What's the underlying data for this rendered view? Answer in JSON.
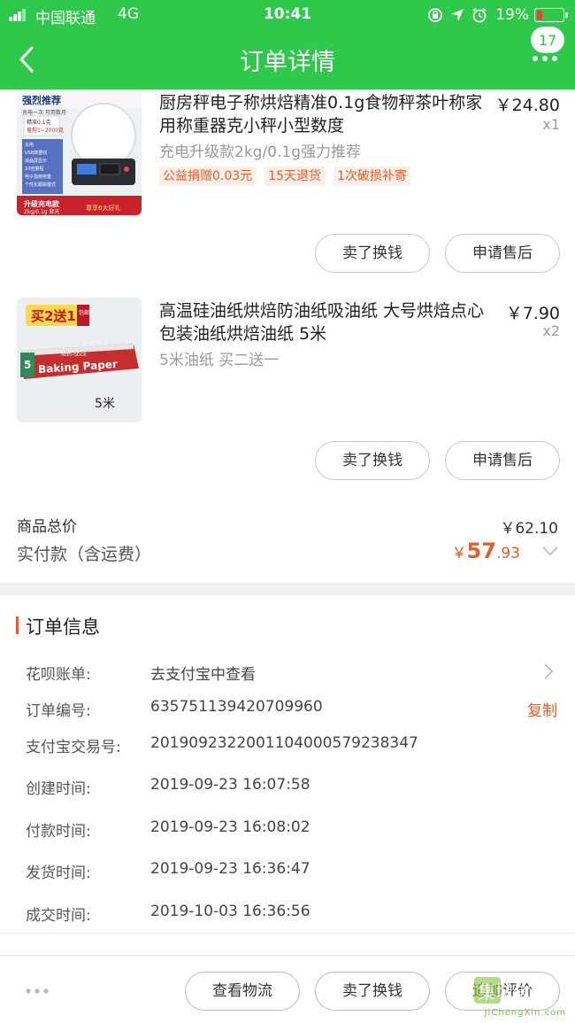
{
  "status_bar": {
    "carrier": "中国联通",
    "network": "4G",
    "time": "10:41",
    "battery_percent": "19%",
    "battery_level": 0.19,
    "icons": [
      "orientation-lock-icon",
      "location-icon",
      "alarm-icon",
      "battery-icon"
    ]
  },
  "nav": {
    "title": "订单详情",
    "badge": "17",
    "back_icon": "chevron-left-icon",
    "more_icon": "more-dots-icon"
  },
  "products": [
    {
      "title": "厨房秤电子称烘焙精准0.1g食物秤茶叶称家用称重器克小秤小型数度",
      "price": "￥24.80",
      "qty": "x1",
      "sku": "充电升级款2kg/0.1g强力推荐",
      "tags": [
        "公益捐赠0.03元",
        "15天退货",
        "1次破损补寄"
      ],
      "buttons": [
        "卖了换钱",
        "申请售后"
      ],
      "image": {
        "banner_top": "强烈推荐",
        "banner_top_sub": "充电一次 可用数月",
        "range_line1": "精准0.1克",
        "range_line2": "量程1~2000克",
        "features": [
          "充电",
          "USB数据线",
          "液晶屏显示",
          "10倍量程",
          "电子指南称重",
          "个性化跟踪模式"
        ],
        "bottom_left": "升级充电款",
        "bottom_left_sub": "2kg/0.1g 背光",
        "bottom_right": "尊享6大好礼"
      }
    },
    {
      "title": "高温硅油纸烘焙防油纸吸油纸 大号烘焙点心包装油纸烘焙油纸 5米",
      "price": "￥7.90",
      "qty": "x2",
      "sku": "5米油纸 买二送一",
      "tags": [],
      "buttons": [
        "卖了换钱",
        "申请售后"
      ],
      "image": {
        "promo": "买2送1",
        "promo_sub": "包邮",
        "brand_small": "Non-Stick",
        "brand": "Baking Paper",
        "box_num": "5",
        "length": "5米"
      }
    }
  ],
  "totals": {
    "goods_total_label": "商品总价",
    "goods_total_value": "￥62.10",
    "paid_label": "实付款（含运费）",
    "paid_currency": "￥",
    "paid_int": "57",
    "paid_dec": ".93"
  },
  "order_info": {
    "title": "订单信息",
    "rows": [
      {
        "label": "花呗账单:",
        "value": "去支付宝中查看"
      },
      {
        "label": "订单编号:",
        "value": "635751139420709960",
        "action": "复制"
      },
      {
        "label": "支付宝交易号:",
        "value": "2019092322001104000579238347"
      },
      {
        "label": "创建时间:",
        "value": "2019-09-23 16:07:58"
      },
      {
        "label": "付款时间:",
        "value": "2019-09-23 16:08:02"
      },
      {
        "label": "发货时间:",
        "value": "2019-09-23 16:36:47"
      },
      {
        "label": "成交时间:",
        "value": "2019-10-03 16:36:56"
      }
    ]
  },
  "bottom_bar": {
    "buttons": [
      "查看物流",
      "卖了换钱",
      "追加评价"
    ]
  },
  "watermark": {
    "text": "JiChengXin.com",
    "logo_glyphs": "集城信"
  },
  "colors": {
    "brand_green": "#2ec84a",
    "accent_orange": "#e85c2a",
    "battery_red": "#ff3b30"
  }
}
